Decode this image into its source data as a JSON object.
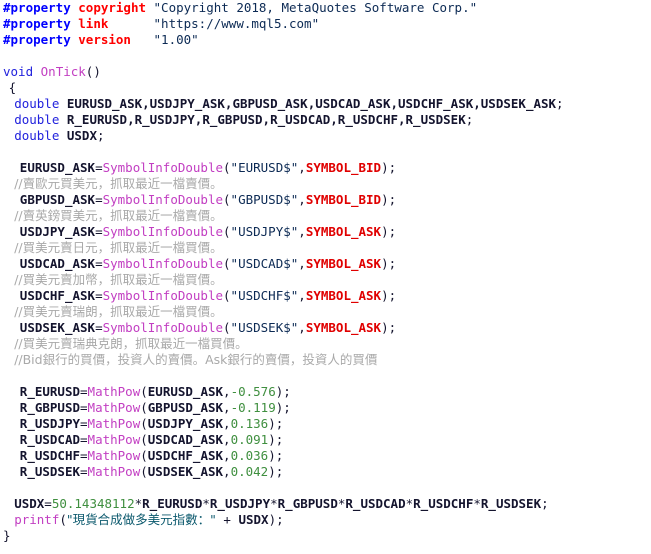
{
  "document": {
    "kind": "source-code",
    "language": "MQL5",
    "background_color": "#ffffff",
    "syntax_colors": {
      "preprocessor": "#0000ff",
      "property_name": "#ff0000",
      "string": "#0c2a54",
      "string_cjk": "#0d5a6e",
      "keyword": "#2222dd",
      "function": "#c23ec2",
      "identifier": "#14142e",
      "constant": "#e00000",
      "number": "#3f8f3f",
      "comment": "#a9a9a9",
      "punctuation": "#14142e"
    }
  },
  "code": {
    "lines": [
      {
        "id": "line-1",
        "indent": 0,
        "tokens": [
          {
            "t": "pre",
            "v": "#property"
          },
          {
            "t": "plain",
            "v": " "
          },
          {
            "t": "propname",
            "v": "copyright"
          },
          {
            "t": "plain",
            "v": " "
          },
          {
            "t": "str",
            "v": "\"Copyright 2018, MetaQuotes Software Corp.\""
          }
        ]
      },
      {
        "id": "line-2",
        "indent": 0,
        "tokens": [
          {
            "t": "pre",
            "v": "#property"
          },
          {
            "t": "plain",
            "v": " "
          },
          {
            "t": "propname",
            "v": "link"
          },
          {
            "t": "plain",
            "v": "      "
          },
          {
            "t": "str",
            "v": "\"https://www.mql5.com\""
          }
        ]
      },
      {
        "id": "line-3",
        "indent": 0,
        "tokens": [
          {
            "t": "pre",
            "v": "#property"
          },
          {
            "t": "plain",
            "v": " "
          },
          {
            "t": "propname",
            "v": "version"
          },
          {
            "t": "plain",
            "v": "   "
          },
          {
            "t": "str",
            "v": "\"1.00\""
          }
        ]
      },
      {
        "id": "line-4",
        "indent": 0,
        "tokens": []
      },
      {
        "id": "line-5",
        "indent": 0,
        "tokens": [
          {
            "t": "kw",
            "v": "void"
          },
          {
            "t": "plain",
            "v": " "
          },
          {
            "t": "fn",
            "v": "OnTick"
          },
          {
            "t": "plain",
            "v": "()"
          }
        ]
      },
      {
        "id": "line-6",
        "indent": 1,
        "tokens": [
          {
            "t": "brace",
            "v": "{"
          }
        ]
      },
      {
        "id": "line-7",
        "indent": 2,
        "tokens": [
          {
            "t": "kw",
            "v": "double"
          },
          {
            "t": "plain",
            "v": " "
          },
          {
            "t": "ident",
            "v": "EURUSD_ASK,USDJPY_ASK,GBPUSD_ASK,USDCAD_ASK,USDCHF_ASK,USDSEK_ASK"
          },
          {
            "t": "plain",
            "v": ";"
          }
        ]
      },
      {
        "id": "line-8",
        "indent": 2,
        "tokens": [
          {
            "t": "kw",
            "v": "double"
          },
          {
            "t": "plain",
            "v": " "
          },
          {
            "t": "ident",
            "v": "R_EURUSD,R_USDJPY,R_GBPUSD,R_USDCAD,R_USDCHF,R_USDSEK"
          },
          {
            "t": "plain",
            "v": ";"
          }
        ]
      },
      {
        "id": "line-9",
        "indent": 2,
        "tokens": [
          {
            "t": "kw",
            "v": "double"
          },
          {
            "t": "plain",
            "v": " "
          },
          {
            "t": "ident",
            "v": "USDX"
          },
          {
            "t": "plain",
            "v": ";"
          }
        ]
      },
      {
        "id": "line-10",
        "indent": 0,
        "tokens": []
      },
      {
        "id": "line-11",
        "indent": 3,
        "tokens": [
          {
            "t": "ident",
            "v": "EURUSD_ASK"
          },
          {
            "t": "plain",
            "v": "="
          },
          {
            "t": "fn",
            "v": "SymbolInfoDouble"
          },
          {
            "t": "plain",
            "v": "("
          },
          {
            "t": "str",
            "v": "\"EURUSD$\""
          },
          {
            "t": "plain",
            "v": ","
          },
          {
            "t": "const",
            "v": "SYMBOL_BID"
          },
          {
            "t": "plain",
            "v": ");"
          }
        ]
      },
      {
        "id": "line-12",
        "indent": 2,
        "tokens": [
          {
            "t": "cmt",
            "v": "//賣歐元買美元，抓取最近一檔賣價。"
          }
        ]
      },
      {
        "id": "line-13",
        "indent": 3,
        "tokens": [
          {
            "t": "ident",
            "v": "GBPUSD_ASK"
          },
          {
            "t": "plain",
            "v": "="
          },
          {
            "t": "fn",
            "v": "SymbolInfoDouble"
          },
          {
            "t": "plain",
            "v": "("
          },
          {
            "t": "str",
            "v": "\"GBPUSD$\""
          },
          {
            "t": "plain",
            "v": ","
          },
          {
            "t": "const",
            "v": "SYMBOL_BID"
          },
          {
            "t": "plain",
            "v": ");"
          }
        ]
      },
      {
        "id": "line-14",
        "indent": 2,
        "tokens": [
          {
            "t": "cmt",
            "v": "//賣英鎊買美元，抓取最近一檔賣價。"
          }
        ]
      },
      {
        "id": "line-15",
        "indent": 3,
        "tokens": [
          {
            "t": "ident",
            "v": "USDJPY_ASK"
          },
          {
            "t": "plain",
            "v": "="
          },
          {
            "t": "fn",
            "v": "SymbolInfoDouble"
          },
          {
            "t": "plain",
            "v": "("
          },
          {
            "t": "str",
            "v": "\"USDJPY$\""
          },
          {
            "t": "plain",
            "v": ","
          },
          {
            "t": "const",
            "v": "SYMBOL_ASK"
          },
          {
            "t": "plain",
            "v": ");"
          }
        ]
      },
      {
        "id": "line-16",
        "indent": 2,
        "tokens": [
          {
            "t": "cmt",
            "v": "//買美元賣日元，抓取最近一檔買價。"
          }
        ]
      },
      {
        "id": "line-17",
        "indent": 3,
        "tokens": [
          {
            "t": "ident",
            "v": "USDCAD_ASK"
          },
          {
            "t": "plain",
            "v": "="
          },
          {
            "t": "fn",
            "v": "SymbolInfoDouble"
          },
          {
            "t": "plain",
            "v": "("
          },
          {
            "t": "str",
            "v": "\"USDCAD$\""
          },
          {
            "t": "plain",
            "v": ","
          },
          {
            "t": "const",
            "v": "SYMBOL_ASK"
          },
          {
            "t": "plain",
            "v": ");"
          }
        ]
      },
      {
        "id": "line-18",
        "indent": 2,
        "tokens": [
          {
            "t": "cmt",
            "v": "//買美元賣加幣，抓取最近一檔買價。"
          }
        ]
      },
      {
        "id": "line-19",
        "indent": 3,
        "tokens": [
          {
            "t": "ident",
            "v": "USDCHF_ASK"
          },
          {
            "t": "plain",
            "v": "="
          },
          {
            "t": "fn",
            "v": "SymbolInfoDouble"
          },
          {
            "t": "plain",
            "v": "("
          },
          {
            "t": "str",
            "v": "\"USDCHF$\""
          },
          {
            "t": "plain",
            "v": ","
          },
          {
            "t": "const",
            "v": "SYMBOL_ASK"
          },
          {
            "t": "plain",
            "v": ");"
          }
        ]
      },
      {
        "id": "line-20",
        "indent": 2,
        "tokens": [
          {
            "t": "cmt",
            "v": "//買美元賣瑞朗，抓取最近一檔買價。"
          }
        ]
      },
      {
        "id": "line-21",
        "indent": 3,
        "tokens": [
          {
            "t": "ident",
            "v": "USDSEK_ASK"
          },
          {
            "t": "plain",
            "v": "="
          },
          {
            "t": "fn",
            "v": "SymbolInfoDouble"
          },
          {
            "t": "plain",
            "v": "("
          },
          {
            "t": "str",
            "v": "\"USDSEK$\""
          },
          {
            "t": "plain",
            "v": ","
          },
          {
            "t": "const",
            "v": "SYMBOL_ASK"
          },
          {
            "t": "plain",
            "v": ");"
          }
        ]
      },
      {
        "id": "line-22",
        "indent": 2,
        "tokens": [
          {
            "t": "cmt",
            "v": "//買美元賣瑞典克朗，抓取最近一檔買價。"
          }
        ]
      },
      {
        "id": "line-23",
        "indent": 2,
        "tokens": [
          {
            "t": "cmt",
            "v": "//Bid銀行的買價，投資人的賣價。Ask銀行的賣價，投資人的買價"
          }
        ]
      },
      {
        "id": "line-24",
        "indent": 0,
        "tokens": []
      },
      {
        "id": "line-25",
        "indent": 3,
        "tokens": [
          {
            "t": "ident",
            "v": "R_EURUSD"
          },
          {
            "t": "plain",
            "v": "="
          },
          {
            "t": "fn",
            "v": "MathPow"
          },
          {
            "t": "plain",
            "v": "("
          },
          {
            "t": "ident",
            "v": "EURUSD_ASK"
          },
          {
            "t": "plain",
            "v": ","
          },
          {
            "t": "num",
            "v": "-0.576"
          },
          {
            "t": "plain",
            "v": ");"
          }
        ]
      },
      {
        "id": "line-26",
        "indent": 3,
        "tokens": [
          {
            "t": "ident",
            "v": "R_GBPUSD"
          },
          {
            "t": "plain",
            "v": "="
          },
          {
            "t": "fn",
            "v": "MathPow"
          },
          {
            "t": "plain",
            "v": "("
          },
          {
            "t": "ident",
            "v": "GBPUSD_ASK"
          },
          {
            "t": "plain",
            "v": ","
          },
          {
            "t": "num",
            "v": "-0.119"
          },
          {
            "t": "plain",
            "v": ");"
          }
        ]
      },
      {
        "id": "line-27",
        "indent": 3,
        "tokens": [
          {
            "t": "ident",
            "v": "R_USDJPY"
          },
          {
            "t": "plain",
            "v": "="
          },
          {
            "t": "fn",
            "v": "MathPow"
          },
          {
            "t": "plain",
            "v": "("
          },
          {
            "t": "ident",
            "v": "USDJPY_ASK"
          },
          {
            "t": "plain",
            "v": ","
          },
          {
            "t": "num",
            "v": "0.136"
          },
          {
            "t": "plain",
            "v": ");"
          }
        ]
      },
      {
        "id": "line-28",
        "indent": 3,
        "tokens": [
          {
            "t": "ident",
            "v": "R_USDCAD"
          },
          {
            "t": "plain",
            "v": "="
          },
          {
            "t": "fn",
            "v": "MathPow"
          },
          {
            "t": "plain",
            "v": "("
          },
          {
            "t": "ident",
            "v": "USDCAD_ASK"
          },
          {
            "t": "plain",
            "v": ","
          },
          {
            "t": "num",
            "v": "0.091"
          },
          {
            "t": "plain",
            "v": ");"
          }
        ]
      },
      {
        "id": "line-29",
        "indent": 3,
        "tokens": [
          {
            "t": "ident",
            "v": "R_USDCHF"
          },
          {
            "t": "plain",
            "v": "="
          },
          {
            "t": "fn",
            "v": "MathPow"
          },
          {
            "t": "plain",
            "v": "("
          },
          {
            "t": "ident",
            "v": "USDCHF_ASK"
          },
          {
            "t": "plain",
            "v": ","
          },
          {
            "t": "num",
            "v": "0.036"
          },
          {
            "t": "plain",
            "v": ");"
          }
        ]
      },
      {
        "id": "line-30",
        "indent": 3,
        "tokens": [
          {
            "t": "ident",
            "v": "R_USDSEK"
          },
          {
            "t": "plain",
            "v": "="
          },
          {
            "t": "fn",
            "v": "MathPow"
          },
          {
            "t": "plain",
            "v": "("
          },
          {
            "t": "ident",
            "v": "USDSEK_ASK"
          },
          {
            "t": "plain",
            "v": ","
          },
          {
            "t": "num",
            "v": "0.042"
          },
          {
            "t": "plain",
            "v": ");"
          }
        ]
      },
      {
        "id": "line-31",
        "indent": 0,
        "tokens": []
      },
      {
        "id": "line-32",
        "indent": 2,
        "tokens": [
          {
            "t": "ident",
            "v": "USDX"
          },
          {
            "t": "plain",
            "v": "="
          },
          {
            "t": "num",
            "v": "50.14348112"
          },
          {
            "t": "plain",
            "v": "*"
          },
          {
            "t": "ident",
            "v": "R_EURUSD"
          },
          {
            "t": "plain",
            "v": "*"
          },
          {
            "t": "ident",
            "v": "R_USDJPY"
          },
          {
            "t": "plain",
            "v": "*"
          },
          {
            "t": "ident",
            "v": "R_GBPUSD"
          },
          {
            "t": "plain",
            "v": "*"
          },
          {
            "t": "ident",
            "v": "R_USDCAD"
          },
          {
            "t": "plain",
            "v": "*"
          },
          {
            "t": "ident",
            "v": "R_USDCHF"
          },
          {
            "t": "plain",
            "v": "*"
          },
          {
            "t": "ident",
            "v": "R_USDSEK"
          },
          {
            "t": "plain",
            "v": ";"
          }
        ]
      },
      {
        "id": "line-33",
        "indent": 2,
        "tokens": [
          {
            "t": "fn",
            "v": "printf"
          },
          {
            "t": "plain",
            "v": "("
          },
          {
            "t": "strcjk",
            "v": "\"現貨合成做多美元指數：\""
          },
          {
            "t": "plain",
            "v": " + "
          },
          {
            "t": "ident",
            "v": "USDX"
          },
          {
            "t": "plain",
            "v": ");"
          }
        ]
      },
      {
        "id": "line-34",
        "indent": 0,
        "tokens": [
          {
            "t": "brace",
            "v": "}"
          }
        ]
      }
    ]
  }
}
